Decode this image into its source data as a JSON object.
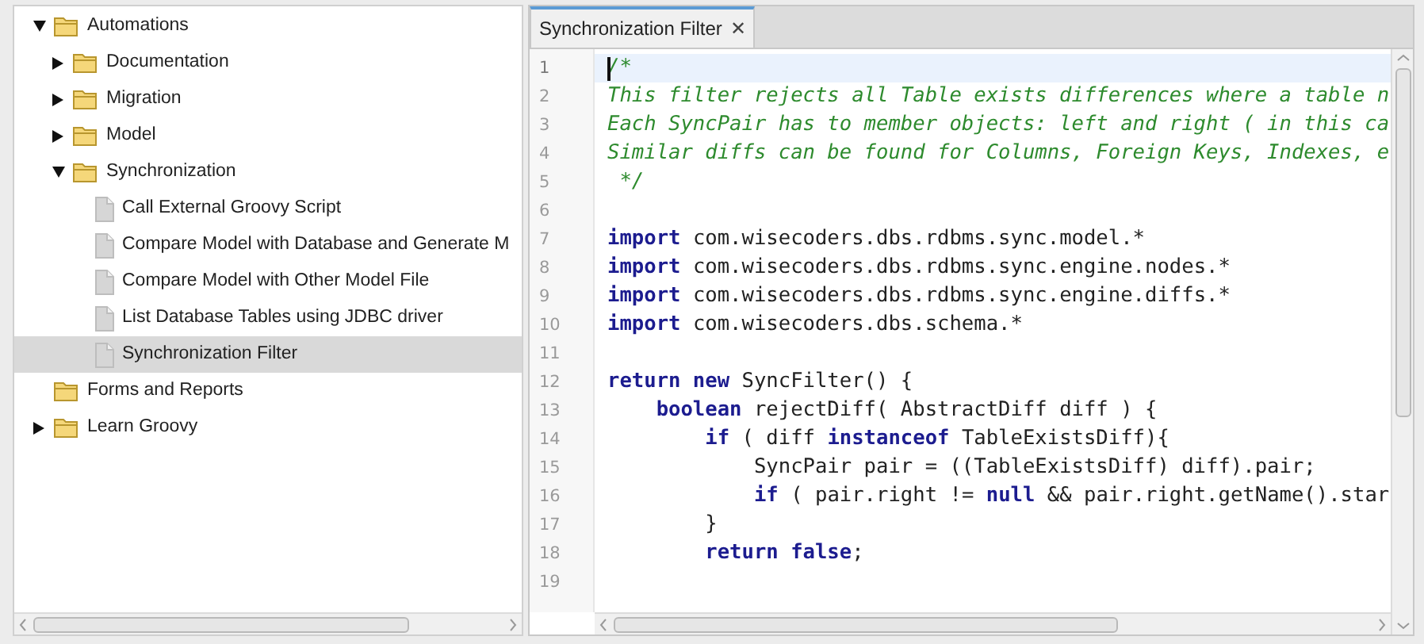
{
  "tree": [
    {
      "label": "Automations",
      "kind": "folder",
      "expanded": true,
      "selected": false,
      "children": [
        {
          "label": "Documentation",
          "kind": "folder",
          "expanded": false,
          "selected": false
        },
        {
          "label": "Migration",
          "kind": "folder",
          "expanded": false,
          "selected": false
        },
        {
          "label": "Model",
          "kind": "folder",
          "expanded": false,
          "selected": false
        },
        {
          "label": "Synchronization",
          "kind": "folder",
          "expanded": true,
          "selected": false,
          "children": [
            {
              "label": "Call External Groovy Script",
              "kind": "file",
              "selected": false
            },
            {
              "label": "Compare Model with Database and Generate M",
              "kind": "file",
              "selected": false
            },
            {
              "label": "Compare Model with Other Model File",
              "kind": "file",
              "selected": false
            },
            {
              "label": "List Database Tables using JDBC driver",
              "kind": "file",
              "selected": false
            },
            {
              "label": "Synchronization Filter",
              "kind": "file",
              "selected": true
            }
          ]
        }
      ]
    },
    {
      "label": "Forms and Reports",
      "kind": "empty_folder",
      "selected": false
    },
    {
      "label": "Learn Groovy",
      "kind": "folder",
      "expanded": false,
      "selected": false
    }
  ],
  "tabs": [
    {
      "label": "Synchronization Filter",
      "close": "✕",
      "selected": true
    }
  ],
  "editor": {
    "lines": [
      {
        "number": "1",
        "current": true,
        "segments": [
          {
            "kind": "comment",
            "text": "/*"
          }
        ]
      },
      {
        "number": "2",
        "current": false,
        "segments": [
          {
            "kind": "comment",
            "text": "This filter rejects all Table exists differences where a table n"
          }
        ]
      },
      {
        "number": "3",
        "current": false,
        "segments": [
          {
            "kind": "comment",
            "text": "Each SyncPair has to member objects: left and right ( in this ca"
          }
        ]
      },
      {
        "number": "4",
        "current": false,
        "segments": [
          {
            "kind": "comment",
            "text": "Similar diffs can be found for Columns, Foreign Keys, Indexes, e"
          }
        ]
      },
      {
        "number": "5",
        "current": false,
        "segments": [
          {
            "kind": "comment",
            "text": " */"
          }
        ]
      },
      {
        "number": "6",
        "current": false
      },
      {
        "number": "7",
        "current": false,
        "segments": [
          {
            "kind": "keyword",
            "text": "import"
          },
          {
            "kind": "plain",
            "text": " com.wisecoders.dbs.rdbms.sync.model.*"
          }
        ]
      },
      {
        "number": "8",
        "current": false,
        "segments": [
          {
            "kind": "keyword",
            "text": "import"
          },
          {
            "kind": "plain",
            "text": " com.wisecoders.dbs.rdbms.sync.engine.nodes.*"
          }
        ]
      },
      {
        "number": "9",
        "current": false,
        "segments": [
          {
            "kind": "keyword",
            "text": "import"
          },
          {
            "kind": "plain",
            "text": " com.wisecoders.dbs.rdbms.sync.engine.diffs.*"
          }
        ]
      },
      {
        "number": "10",
        "current": false,
        "segments": [
          {
            "kind": "keyword",
            "text": "import"
          },
          {
            "kind": "plain",
            "text": " com.wisecoders.dbs.schema.*"
          }
        ]
      },
      {
        "number": "11",
        "current": false
      },
      {
        "number": "12",
        "current": false,
        "segments": [
          {
            "kind": "keyword",
            "text": "return new"
          },
          {
            "kind": "plain",
            "text": " SyncFilter() {"
          }
        ]
      },
      {
        "number": "13",
        "current": false,
        "segments": [
          {
            "kind": "keyword",
            "text": "    boolean"
          },
          {
            "kind": "plain",
            "text": " rejectDiff( AbstractDiff diff ) {"
          }
        ]
      },
      {
        "number": "14",
        "current": false,
        "segments": [
          {
            "kind": "keyword",
            "text": "        if"
          },
          {
            "kind": "plain",
            "text": " ( diff "
          },
          {
            "kind": "keyword",
            "text": "instanceof"
          },
          {
            "kind": "plain",
            "text": " TableExistsDiff){"
          }
        ]
      },
      {
        "number": "15",
        "current": false,
        "segments": [
          {
            "kind": "plain",
            "text": "            SyncPair pair = ((TableExistsDiff) diff).pair;"
          }
        ]
      },
      {
        "number": "16",
        "current": false,
        "segments": [
          {
            "kind": "keyword",
            "text": "            if"
          },
          {
            "kind": "plain",
            "text": " ( pair.right != "
          },
          {
            "kind": "keyword",
            "text": "null"
          },
          {
            "kind": "plain",
            "text": " && pair.right.getName().star"
          }
        ]
      },
      {
        "number": "17",
        "current": false,
        "segments": [
          {
            "kind": "plain",
            "text": "        }"
          }
        ]
      },
      {
        "number": "18",
        "current": false,
        "segments": [
          {
            "kind": "keyword",
            "text": "        return false"
          },
          {
            "kind": "plain",
            "text": ";"
          }
        ]
      },
      {
        "number": "19",
        "current": false
      }
    ]
  }
}
